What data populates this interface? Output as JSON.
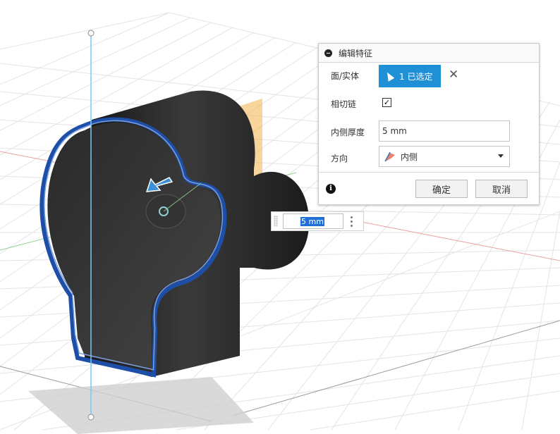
{
  "dialog": {
    "title": "编辑特征",
    "rows": {
      "faces_label": "面/实体",
      "selection_label": "1 已选定",
      "tangent_chain_label": "相切链",
      "tangent_chain_checked": true,
      "thickness_label": "内侧厚度",
      "thickness_value": "5 mm",
      "direction_label": "方向",
      "direction_value": "内侧"
    },
    "ok_label": "确定",
    "cancel_label": "取消"
  },
  "manipulator": {
    "value": "5 mm"
  },
  "viewport": {
    "model_color": "#2b2b2b",
    "selected_edge_color": "#1e4fa8",
    "axis_color": "#7cc7f0",
    "plane_color": "#f3b34d"
  },
  "icons": {
    "collapse": "minus-circle-icon",
    "selection": "cursor-arrow-icon",
    "clear": "close-icon",
    "direction": "flag-icon",
    "info": "info-icon",
    "arrow": "thickness-arrow-icon"
  }
}
